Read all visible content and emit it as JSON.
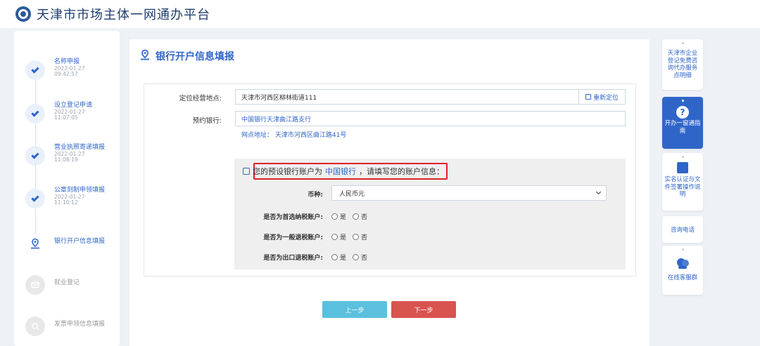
{
  "header": {
    "title": "天津市市场主体一网通办平台"
  },
  "steps": [
    {
      "label": "名称申报",
      "date": "2022-01-27",
      "time": "09:42:57",
      "status": "done"
    },
    {
      "label": "设立登记申请",
      "date": "2022-01-27",
      "time": "11:07:05",
      "status": "done"
    },
    {
      "label": "营业执照寄递填报",
      "date": "2022-01-27",
      "time": "11:08:19",
      "status": "done"
    },
    {
      "label": "公章刻制申领填报",
      "date": "2022-01-27",
      "time": "11:10:12",
      "status": "done"
    },
    {
      "label": "银行开户信息填报",
      "status": "current"
    },
    {
      "label": "就业登记",
      "status": "todo"
    },
    {
      "label": "发票申领信息填报",
      "status": "todo"
    }
  ],
  "main": {
    "title": "银行开户信息填报",
    "location_label": "定位经营地点:",
    "location_value": "天津市河西区柳林街道111",
    "relocate_label": "重新定位",
    "bank_label": "预约银行:",
    "bank_value": "中国银行天津曲江路支行",
    "branch_address": "网点地址： 天津市河西区曲江路41号",
    "account": {
      "msg_prefix": "您的预设银行账户为",
      "msg_bank": "中国银行",
      "msg_suffix": "，请填写您的账户信息：",
      "currency_label": "币种:",
      "currency_value": "人民币元",
      "tax_primary_label": "是否为首选纳税账户:",
      "tax_refund_label": "是否为一般退税账户:",
      "export_refund_label": "是否为出口退税账户:",
      "yes": "是",
      "no": "否"
    },
    "prev_label": "上一步",
    "next_label": "下一步"
  },
  "side_widgets": {
    "consult_fee": "天津市企业登记免费咨询代办服务点明细",
    "guide": "开办一窗通指南",
    "realname": "实名认证与文件签署操作说明",
    "phone": "咨询电话",
    "online": "在线客服群"
  },
  "colors": {
    "accent": "#2f65c8",
    "prev_button": "#5bc0de",
    "next_button": "#d9534f",
    "highlight_frame": "#e0202a"
  }
}
